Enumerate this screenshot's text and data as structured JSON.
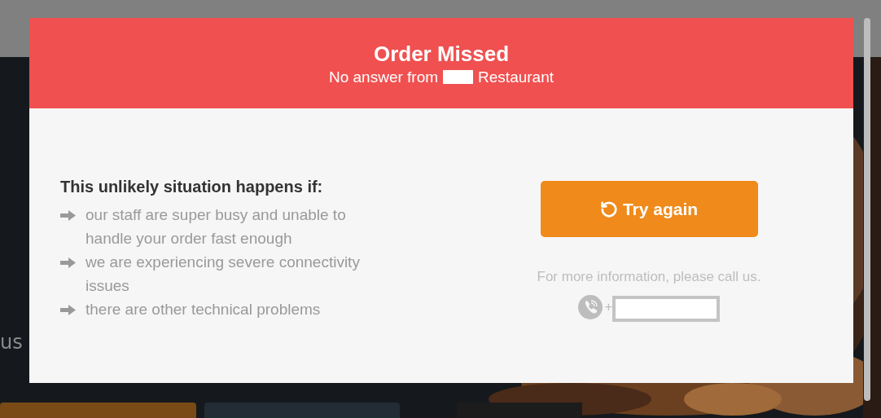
{
  "background": {
    "hero_subtitle": "us"
  },
  "modal": {
    "title": "Order Missed",
    "subtitle_before": "No answer from",
    "subtitle_after": "Restaurant",
    "reasons_heading": "This unlikely situation happens if:",
    "reasons": [
      "our staff are super busy and unable to handle your order fast enough",
      "we are experiencing severe connectivity issues",
      "there are other technical problems"
    ],
    "retry_button": "Try again",
    "info_text": "For more information, please call us.",
    "phone_prefix": "+"
  }
}
